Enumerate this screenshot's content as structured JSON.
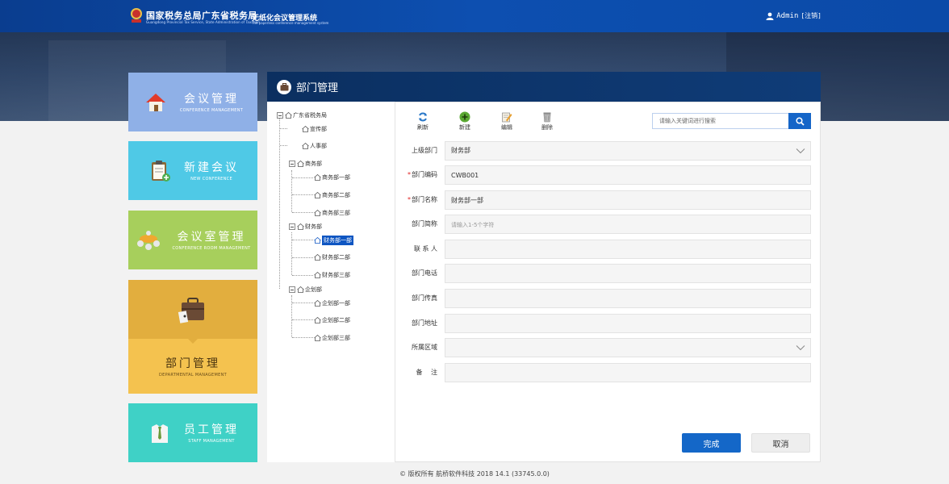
{
  "header": {
    "org_cn": "国家税务总局广东省税务局",
    "org_en": "Guangdong Provincial Tax Service, State Administration of Taxation",
    "system_cn": "无纸化会议管理系统",
    "system_en": "The paperless conference management system",
    "username": "Admin",
    "logout_label": "[注销]"
  },
  "nav": {
    "meeting": {
      "cn": "会议管理",
      "en": "CONFERENCE MANAGEMENT"
    },
    "new_meeting": {
      "cn": "新建会议",
      "en": "NEW CONFERENCE"
    },
    "room": {
      "cn": "会议室管理",
      "en": "CONFERENCE ROOM MANAGEMENT"
    },
    "department": {
      "cn": "部门管理",
      "en": "DEPARTMENTAL MANAGEMENT"
    },
    "staff": {
      "cn": "员工管理",
      "en": "STAFF MANAGEMENT"
    }
  },
  "panel": {
    "title": "部门管理"
  },
  "tree": {
    "root": "广东省税务局",
    "n1": "宣传部",
    "n2": "人事部",
    "n3": "商务部",
    "n3a": "商务部一部",
    "n3b": "商务部二部",
    "n3c": "商务部三部",
    "n4": "财务部",
    "n4a": "财务部一部",
    "n4b": "财务部二部",
    "n4c": "财务部三部",
    "n5": "企划部",
    "n5a": "企划部一部",
    "n5b": "企划部二部",
    "n5c": "企划部三部"
  },
  "toolbar": {
    "refresh": "刷新",
    "new": "新建",
    "edit": "编辑",
    "delete": "删除",
    "search_placeholder": "请输入关键词进行搜索"
  },
  "form": {
    "parent_label": "上级部门",
    "parent_value": "财务部",
    "code_label": "部门编码",
    "code_value": "CWB001",
    "name_label": "部门名称",
    "name_value": "财务部一部",
    "abbr_label": "部门简称",
    "abbr_placeholder": "请输入1-5个字符",
    "contact_label": "联 系 人",
    "phone_label": "部门电话",
    "fax_label": "部门传真",
    "address_label": "部门地址",
    "region_label": "所属区域",
    "note_label": "备　 注",
    "required_mark": "*"
  },
  "actions": {
    "done": "完成",
    "cancel": "取消"
  },
  "footer": {
    "copyright": "© 版权所有 航桥软件科技 2018   14.1 (33745.0.0)"
  },
  "colors": {
    "primary": "#1467c8",
    "header": "#0d4fb0"
  }
}
